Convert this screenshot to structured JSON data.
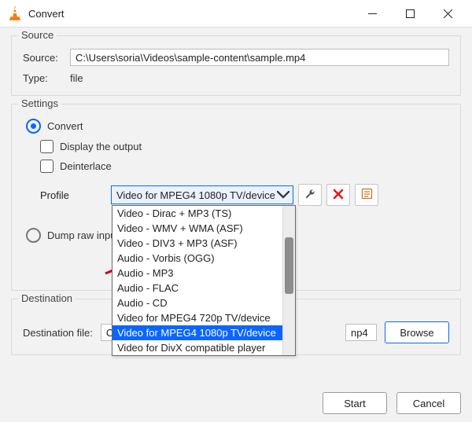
{
  "window_title": "Convert",
  "source": {
    "legend": "Source",
    "source_label": "Source:",
    "source_value": "C:\\Users\\soria\\Videos\\sample-content\\sample.mp4",
    "type_label": "Type:",
    "type_value": "file"
  },
  "settings": {
    "legend": "Settings",
    "convert_label": "Convert",
    "display_output_label": "Display the output",
    "deinterlace_label": "Deinterlace",
    "profile_label": "Profile",
    "profile_selected": "Video for MPEG4 1080p TV/device",
    "profile_options": [
      "Video - Dirac + MP3 (TS)",
      "Video - WMV + WMA (ASF)",
      "Video - DIV3 + MP3 (ASF)",
      "Audio - Vorbis (OGG)",
      "Audio - MP3",
      "Audio - FLAC",
      "Audio - CD",
      "Video for MPEG4 720p TV/device",
      "Video for MPEG4 1080p TV/device",
      "Video for DivX compatible player"
    ],
    "profile_highlight_index": 8,
    "dump_raw_label": "Dump raw input"
  },
  "destination": {
    "legend": "Destination",
    "file_label": "Destination file:",
    "file_value_left": "C:\\Users",
    "file_value_right": "np4",
    "browse_label": "Browse"
  },
  "buttons": {
    "start": "Start",
    "cancel": "Cancel"
  }
}
